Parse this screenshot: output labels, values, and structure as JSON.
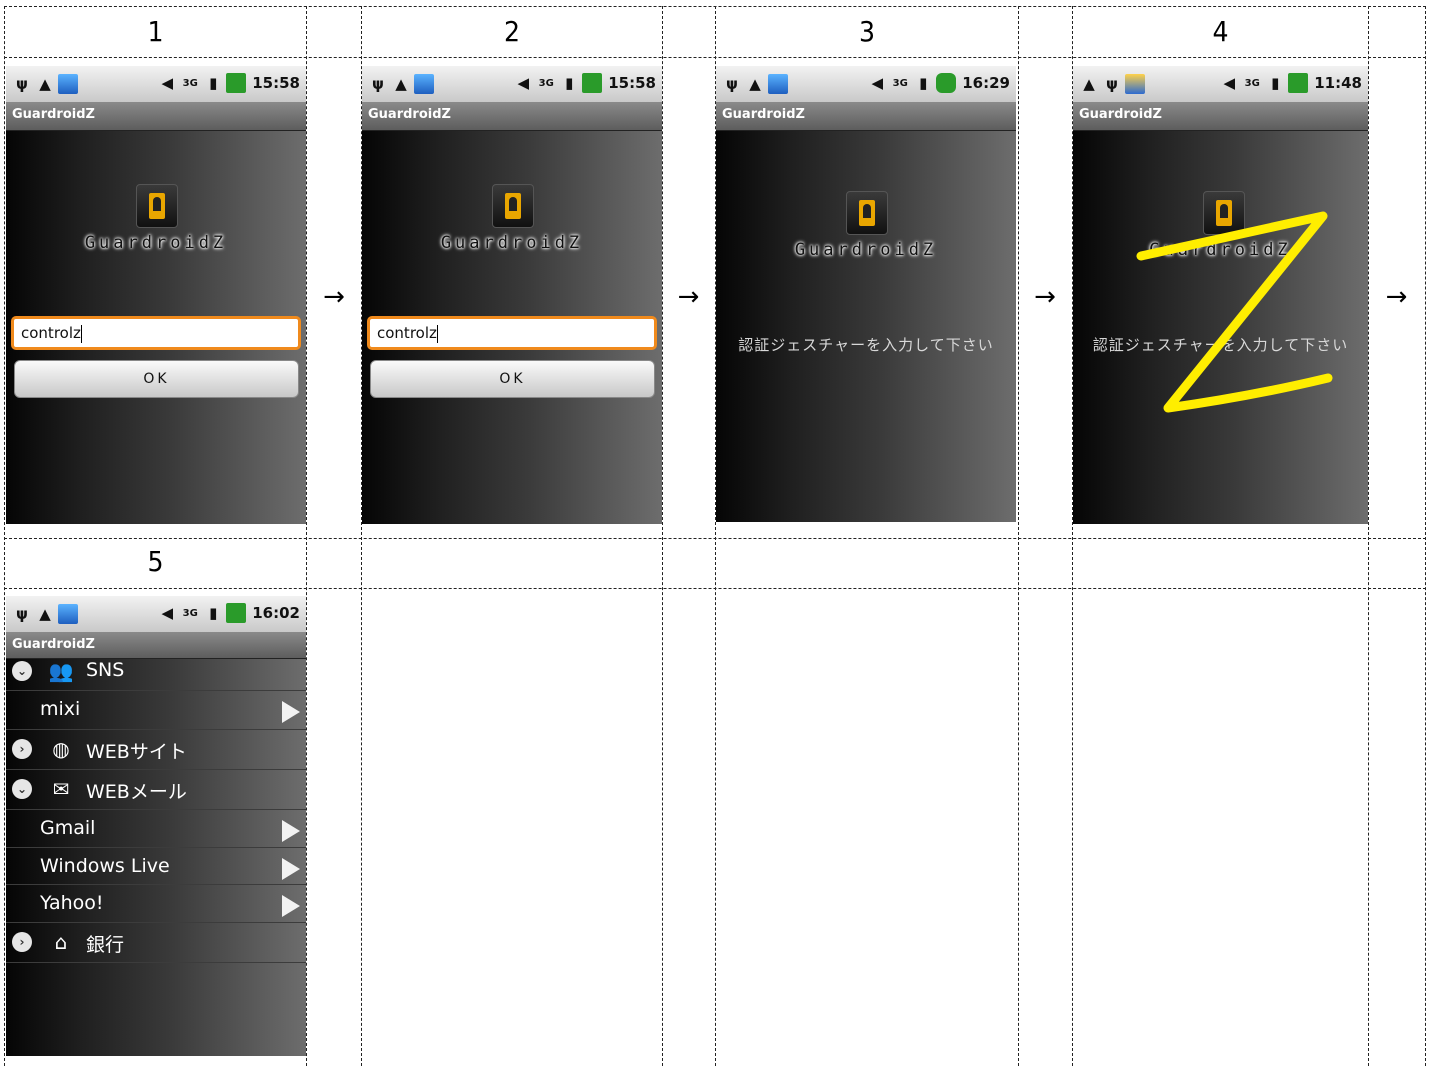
{
  "steps": [
    "1",
    "2",
    "3",
    "4",
    "5"
  ],
  "arrow": "→",
  "app": {
    "title": "GuardroidZ",
    "logo_text": "GuardroidZ",
    "password_value": "controlz",
    "ok_label": "OK",
    "gesture_prompt": "認証ジェスチャーを入力して下さい"
  },
  "status_times": [
    "15:58",
    "15:58",
    "16:29",
    "11:48",
    "16:02"
  ],
  "list": {
    "sns": "SNS",
    "mixi": "mixi",
    "web_sites": "WEBサイト",
    "web_mail": "WEBメール",
    "gmail": "Gmail",
    "windows_live": "Windows Live",
    "yahoo": "Yahoo!",
    "bank": "銀行"
  },
  "colors": {
    "input_focus": "#f08a1c",
    "gesture": "#ffee00"
  }
}
